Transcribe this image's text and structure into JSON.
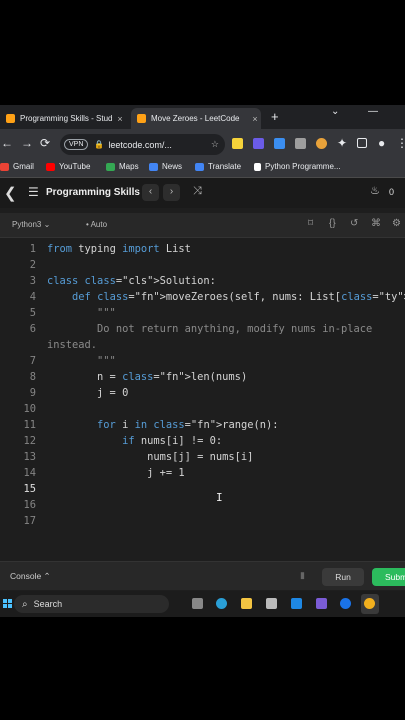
{
  "browser": {
    "tabs": [
      {
        "title": "Programming Skills - Stud",
        "close": "×"
      },
      {
        "title": "Move Zeroes - LeetCode",
        "close": "×"
      }
    ],
    "new_tab": "+",
    "url": "leetcode.com/...",
    "vpn": "VPN",
    "bookmarks": [
      "Gmail",
      "YouTube",
      "Maps",
      "News",
      "Translate",
      "Python Programme..."
    ]
  },
  "header": {
    "title": "Programming Skills",
    "streak": "0"
  },
  "editor": {
    "language": "Python3",
    "mode": "Auto",
    "current_line": 15,
    "lines": [
      "from typing import List",
      "",
      "class Solution:",
      "    def moveZeroes(self, nums: List[int]) -> None:",
      "        \"\"\"",
      "        Do not return anything, modify nums in-place",
      "instead.",
      "        \"\"\"",
      "        n = len(nums)",
      "        j = 0",
      "",
      "        for i in range(n):",
      "            if nums[i] != 0:",
      "                nums[j] = nums[i]",
      "                j += 1",
      "",
      "",
      ""
    ],
    "line_numbers": [
      "1",
      "2",
      "3",
      "4",
      "5",
      "6",
      "",
      "7",
      "8",
      "9",
      "10",
      "11",
      "12",
      "13",
      "14",
      "15",
      "16",
      "17"
    ]
  },
  "console": {
    "label": "Console",
    "run": "Run",
    "submit": "Submit"
  },
  "taskbar": {
    "search": "Search"
  },
  "colors": {
    "accent_green": "#2cbb5d",
    "keyword": "#569cd6",
    "class_name": "#4ec9b0",
    "function": "#dcdcaa"
  }
}
